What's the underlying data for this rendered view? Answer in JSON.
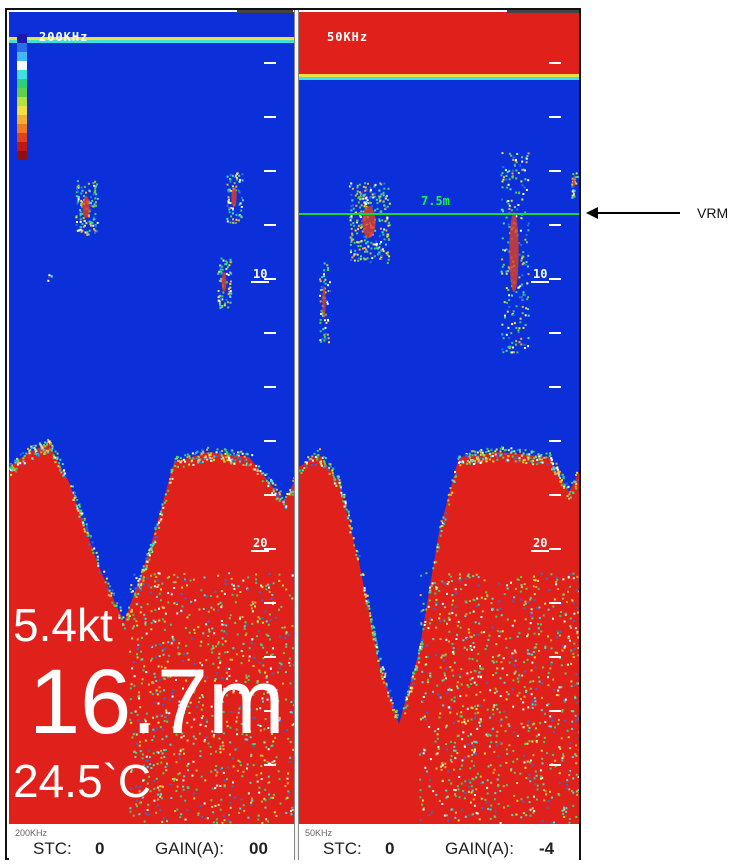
{
  "left_panel": {
    "freq_label": "200KHz",
    "range_marks": [
      "10",
      "20"
    ],
    "speed": "5.4kt",
    "depth": "16.7m",
    "temperature": "24.5`C",
    "status": {
      "freq": "200KHz",
      "stc_label": "STC:",
      "stc_value": "0",
      "gain_label": "GAIN(A):",
      "gain_value": "00"
    }
  },
  "right_panel": {
    "freq_label": "50KHz",
    "range_marks": [
      "10",
      "20"
    ],
    "vrm_value": "7.5m",
    "status": {
      "freq": "50KHz",
      "stc_label": "STC:",
      "stc_value": "0",
      "gain_label": "GAIN(A):",
      "gain_value": "-4"
    }
  },
  "annotation": {
    "label": "VRM"
  },
  "colors": {
    "water": "#0b2fd9",
    "bottom": "#e0201a",
    "vrm": "#19d63a",
    "scale": [
      "#1a1ab0",
      "#2d6fe0",
      "#45b8f0",
      "#ffffff",
      "#3ee0e0",
      "#2ed07a",
      "#5ed04a",
      "#b8e040",
      "#f0e040",
      "#f0b030",
      "#f07a20",
      "#e04020",
      "#c01818",
      "#901010"
    ]
  }
}
